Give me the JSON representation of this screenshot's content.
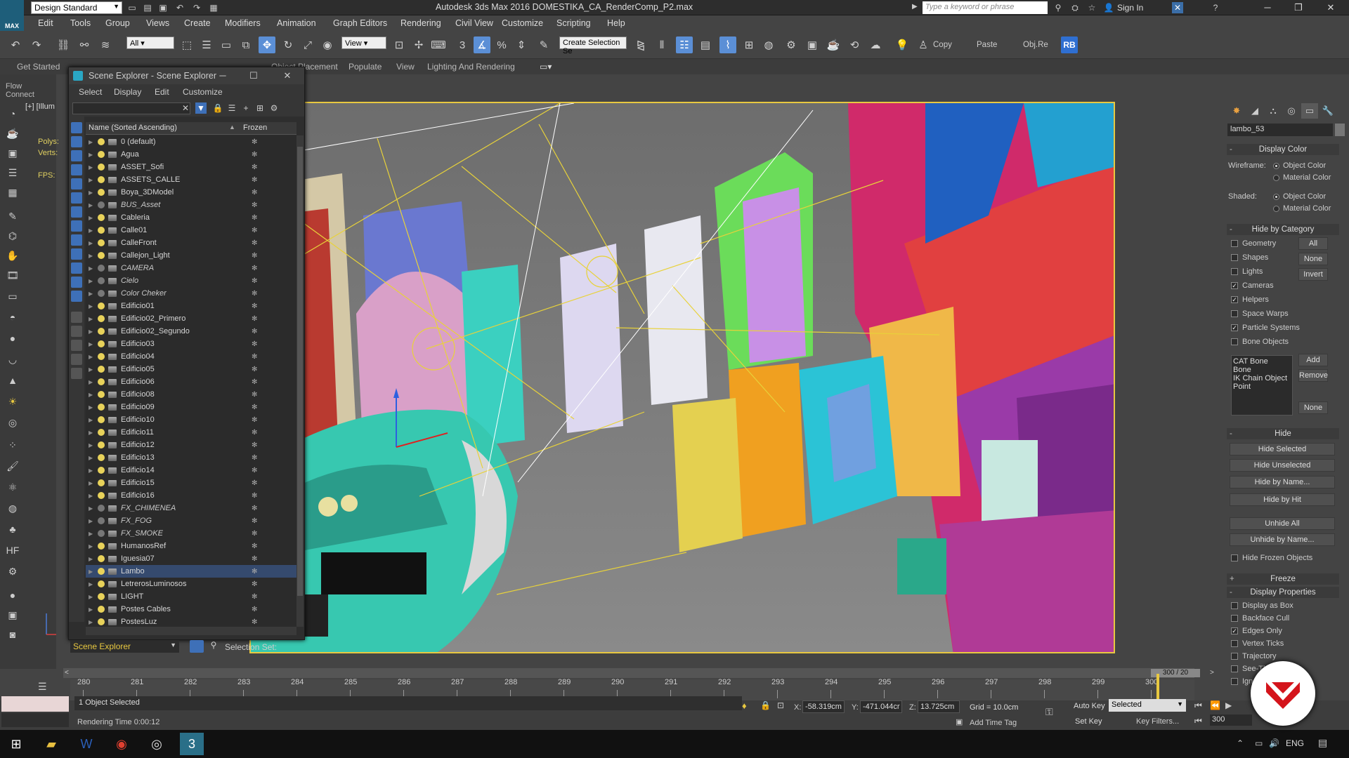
{
  "app": {
    "workspace": "Design Standard",
    "title": "Autodesk 3ds Max 2016    DOMESTIKA_CA_RenderComp_P2.max",
    "search_placeholder": "Type a keyword or phrase",
    "sign_in": "Sign In",
    "logo": "MAX"
  },
  "menus": [
    "Edit",
    "Tools",
    "Group",
    "Views",
    "Create",
    "Modifiers",
    "Animation",
    "Graph Editors",
    "Rendering",
    "Civil View",
    "Customize",
    "Scripting",
    "Help"
  ],
  "toolbar": {
    "filter": "All",
    "ref_coord": "View",
    "selection_set": "Create Selection Se",
    "copy": "Copy",
    "paste": "Paste",
    "objre": "Obj.Re",
    "rb": "RB"
  },
  "ribbon_tabs": [
    "Get Started",
    "Object Placement",
    "Populate",
    "View",
    "Lighting And Rendering"
  ],
  "flow_connect": "Flow Connect",
  "viewport": {
    "label": "[+] [Illum",
    "stats": {
      "polys": "Polys:",
      "verts": "Verts:",
      "fps": "FPS:"
    }
  },
  "scene_explorer": {
    "title": "Scene Explorer - Scene Explorer",
    "menu": [
      "Select",
      "Display",
      "Edit",
      "Customize"
    ],
    "col_name": "Name (Sorted Ascending)",
    "col_frozen": "Frozen",
    "footer_label": "Scene Explorer",
    "selection_set_label": "Selection Set:",
    "layers": [
      {
        "name": "0 (default)",
        "italic": false,
        "on": true
      },
      {
        "name": "Agua",
        "italic": false,
        "on": true
      },
      {
        "name": "ASSET_Sofi",
        "italic": false,
        "on": true
      },
      {
        "name": "ASSETS_CALLE",
        "italic": false,
        "on": true
      },
      {
        "name": "Boya_3DModel",
        "italic": false,
        "on": true
      },
      {
        "name": "BUS_Asset",
        "italic": true,
        "on": false
      },
      {
        "name": "Cableria",
        "italic": false,
        "on": true
      },
      {
        "name": "Calle01",
        "italic": false,
        "on": true
      },
      {
        "name": "CalleFront",
        "italic": false,
        "on": true
      },
      {
        "name": "Callejon_Light",
        "italic": false,
        "on": true
      },
      {
        "name": "CAMERA",
        "italic": true,
        "on": false
      },
      {
        "name": "Cielo",
        "italic": true,
        "on": false
      },
      {
        "name": "Color Cheker",
        "italic": true,
        "on": false
      },
      {
        "name": "Edificio01",
        "italic": false,
        "on": true
      },
      {
        "name": "Edificio02_Primero",
        "italic": false,
        "on": true
      },
      {
        "name": "Edificio02_Segundo",
        "italic": false,
        "on": true
      },
      {
        "name": "Edificio03",
        "italic": false,
        "on": true
      },
      {
        "name": "Edificio04",
        "italic": false,
        "on": true
      },
      {
        "name": "Edificio05",
        "italic": false,
        "on": true
      },
      {
        "name": "Edificio06",
        "italic": false,
        "on": true
      },
      {
        "name": "Edificio08",
        "italic": false,
        "on": true
      },
      {
        "name": "Edificio09",
        "italic": false,
        "on": true
      },
      {
        "name": "Edificio10",
        "italic": false,
        "on": true
      },
      {
        "name": "Edificio11",
        "italic": false,
        "on": true
      },
      {
        "name": "Edificio12",
        "italic": false,
        "on": true
      },
      {
        "name": "Edificio13",
        "italic": false,
        "on": true
      },
      {
        "name": "Edificio14",
        "italic": false,
        "on": true
      },
      {
        "name": "Edificio15",
        "italic": false,
        "on": true
      },
      {
        "name": "Edificio16",
        "italic": false,
        "on": true
      },
      {
        "name": "FX_CHIMENEA",
        "italic": true,
        "on": false
      },
      {
        "name": "FX_FOG",
        "italic": true,
        "on": false
      },
      {
        "name": "FX_SMOKE",
        "italic": true,
        "on": false
      },
      {
        "name": "HumanosRef",
        "italic": false,
        "on": true
      },
      {
        "name": "Iguesia07",
        "italic": false,
        "on": true
      },
      {
        "name": "Lambo",
        "italic": false,
        "on": true,
        "selected": true
      },
      {
        "name": "LetrerosLuminosos",
        "italic": false,
        "on": true
      },
      {
        "name": "LIGHT",
        "italic": false,
        "on": true
      },
      {
        "name": "Postes Cables",
        "italic": false,
        "on": true
      },
      {
        "name": "PostesLuz",
        "italic": false,
        "on": true
      }
    ]
  },
  "command_panel": {
    "object_name": "lambo_53",
    "display_color": {
      "title": "Display Color",
      "wireframe": "Wireframe:",
      "shaded": "Shaded:",
      "object_color": "Object Color",
      "material_color": "Material Color"
    },
    "hide_by_category": {
      "title": "Hide by Category",
      "items": [
        {
          "label": "Geometry",
          "checked": false
        },
        {
          "label": "Shapes",
          "checked": false
        },
        {
          "label": "Lights",
          "checked": false
        },
        {
          "label": "Cameras",
          "checked": true
        },
        {
          "label": "Helpers",
          "checked": true
        },
        {
          "label": "Space Warps",
          "checked": false
        },
        {
          "label": "Particle Systems",
          "checked": true
        },
        {
          "label": "Bone Objects",
          "checked": false
        }
      ],
      "all": "All",
      "none": "None",
      "invert": "Invert",
      "list": [
        "CAT Bone",
        "Bone",
        "IK Chain Object",
        "Point"
      ],
      "add": "Add",
      "remove": "Remove",
      "none2": "None"
    },
    "hide": {
      "title": "Hide",
      "hide_selected": "Hide Selected",
      "hide_unselected": "Hide Unselected",
      "hide_by_name": "Hide by Name...",
      "hide_by_hit": "Hide by Hit",
      "unhide_all": "Unhide All",
      "unhide_by_name": "Unhide by Name...",
      "hide_frozen": "Hide Frozen Objects"
    },
    "freeze": {
      "title": "Freeze"
    },
    "display_properties": {
      "title": "Display Properties",
      "items": [
        {
          "label": "Display as Box",
          "checked": false
        },
        {
          "label": "Backface Cull",
          "checked": false
        },
        {
          "label": "Edges Only",
          "checked": true
        },
        {
          "label": "Vertex Ticks",
          "checked": false
        },
        {
          "label": "Trajectory",
          "checked": false
        },
        {
          "label": "See-Through",
          "checked": false
        },
        {
          "label": "Ignore Extents",
          "checked": false
        }
      ]
    }
  },
  "timeline": {
    "slider": "300 / 20",
    "ticks": [
      280,
      281,
      282,
      283,
      284,
      285,
      286,
      287,
      288,
      289,
      290,
      291,
      292,
      293,
      294,
      295,
      296,
      297,
      298,
      299,
      300
    ]
  },
  "status": {
    "selection": "1 Object Selected",
    "render_time": "Rendering Time  0:00:12",
    "x_label": "X:",
    "x": "-58.319cm",
    "y_label": "Y:",
    "y": "-471.044cr",
    "z_label": "Z:",
    "z": "13.725cm",
    "grid": "Grid = 10.0cm",
    "add_time_tag": "Add Time Tag",
    "auto_key": "Auto Key",
    "key_mode": "Selected",
    "set_key": "Set Key",
    "key_filters": "Key Filters...",
    "frame": "300"
  },
  "taskbar": {
    "lang": "ENG"
  },
  "colors": {
    "accent_blue": "#5b8fd6",
    "viewport_border": "#e8c840",
    "badge_red": "#d4141b"
  }
}
